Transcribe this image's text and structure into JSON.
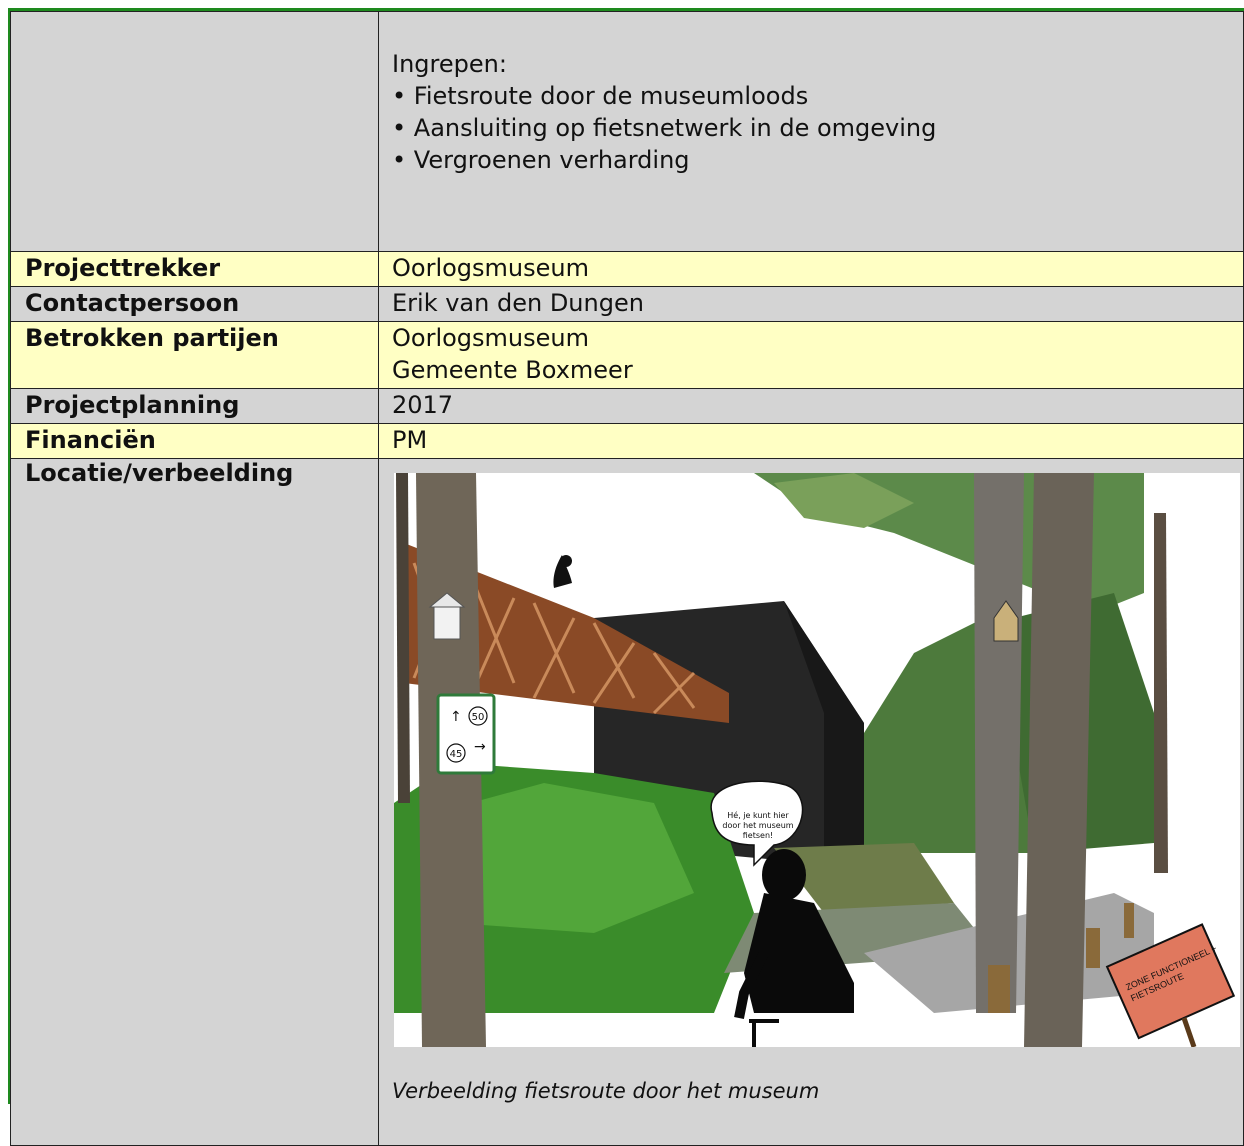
{
  "top": {
    "heading": "Ingrepen:",
    "items": [
      "Fietsroute door de museumloods",
      "Aansluiting op fietsnetwerk in de omgeving",
      "Vergroenen verharding"
    ]
  },
  "rows": {
    "projecttrekker": {
      "label": "Projecttrekker",
      "value": "Oorlogsmuseum"
    },
    "contactpersoon": {
      "label": "Contactpersoon",
      "value": "Erik van den Dungen"
    },
    "partijen": {
      "label": "Betrokken partijen",
      "values": [
        "Oorlogsmuseum",
        "Gemeente Boxmeer"
      ]
    },
    "planning": {
      "label": "Projectplanning",
      "value": "2017"
    },
    "financien": {
      "label": "Financiën",
      "value": "PM"
    },
    "locatie": {
      "label": "Locatie/verbeelding"
    }
  },
  "illustration": {
    "speech_bubble": [
      "Hé, je kunt hier",
      "door het museum",
      "fietsen!"
    ],
    "sign_text": [
      "ZONE FUNCTIONEEL +",
      "FIETSROUTE"
    ],
    "route_numbers": [
      "50",
      "45"
    ],
    "caption": "Verbeelding fietsroute door het museum"
  },
  "colors": {
    "border_accent": "#1e8a1e",
    "label_bg": "#ffffc4",
    "grey_bg": "#d4d4d4",
    "sign_bg": "#e0785e"
  }
}
